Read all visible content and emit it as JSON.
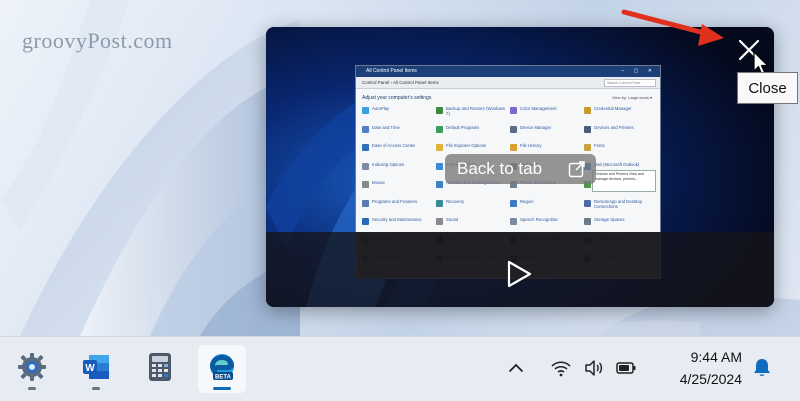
{
  "watermark": "groovyPost.com",
  "pip": {
    "back_to_tab_label": "Back to tab",
    "close_tooltip": "Close",
    "inner_window": {
      "title": "All Control Panel Items",
      "address": "Control Panel  ›  All Control Panel Items",
      "search_placeholder": "Search Control Panel",
      "heading": "Adjust your computer's settings",
      "view_by": "View by:  Large icons ▾",
      "tooltip_text": "Devices and Printers  View and manage devices, printers...",
      "items": [
        {
          "label": "AutoPlay",
          "icon_color": "#3aa0e0"
        },
        {
          "label": "Backup and Restore (Windows 7)",
          "icon_color": "#3b8a3b"
        },
        {
          "label": "Color Management",
          "icon_color": "#7a6ad0"
        },
        {
          "label": "Credential Manager",
          "icon_color": "#c99a2a"
        },
        {
          "label": "Date and Time",
          "icon_color": "#4f7fc8"
        },
        {
          "label": "Default Programs",
          "icon_color": "#3a9d5a"
        },
        {
          "label": "Device Manager",
          "icon_color": "#5a6e8a"
        },
        {
          "label": "Devices and Printers",
          "icon_color": "#4a5e7a"
        },
        {
          "label": "Ease of Access Center",
          "icon_color": "#2f6fc0"
        },
        {
          "label": "File Explorer Options",
          "icon_color": "#e0b23a"
        },
        {
          "label": "File History",
          "icon_color": "#d8a030"
        },
        {
          "label": "Fonts",
          "icon_color": "#c9a23a"
        },
        {
          "label": "Indexing Options",
          "icon_color": "#7d8da3"
        },
        {
          "label": "Internet Options",
          "icon_color": "#3a8ad8"
        },
        {
          "label": "Keyboard",
          "icon_color": "#777777"
        },
        {
          "label": "Mail (Microsoft Outlook)",
          "icon_color": "#2b6cc4"
        },
        {
          "label": "Mouse",
          "icon_color": "#888888"
        },
        {
          "label": "Network and Sharing Center",
          "icon_color": "#3f7fc4"
        },
        {
          "label": "Phone and Modem",
          "icon_color": "#6f7f90"
        },
        {
          "label": "Power Options",
          "icon_color": "#4a9a4a"
        },
        {
          "label": "Programs and Features",
          "icon_color": "#5a7ab0"
        },
        {
          "label": "Recovery",
          "icon_color": "#3a8a9a"
        },
        {
          "label": "Region",
          "icon_color": "#3a7ac8"
        },
        {
          "label": "RemoteApp and Desktop Connections",
          "icon_color": "#4a6aa8"
        },
        {
          "label": "Security and Maintenance",
          "icon_color": "#2a6ab8"
        },
        {
          "label": "Sound",
          "icon_color": "#888888"
        },
        {
          "label": "Speech Recognition",
          "icon_color": "#7a8aa0"
        },
        {
          "label": "Storage Spaces",
          "icon_color": "#6a7a8a"
        },
        {
          "label": "Sync Center",
          "icon_color": "#3aa04a"
        },
        {
          "label": "System",
          "icon_color": "#4a6a9a"
        },
        {
          "label": "Taskbar and Navigation",
          "icon_color": "#4a7ab8"
        },
        {
          "label": "Troubleshooting",
          "icon_color": "#5a7aa8"
        },
        {
          "label": "User Accounts",
          "icon_color": "#4a8ac8"
        },
        {
          "label": "Windows Defender Firewall",
          "icon_color": "#b84a3a"
        },
        {
          "label": "Windows Tools",
          "icon_color": "#6a7a8a"
        },
        {
          "label": "Work Folders",
          "icon_color": "#3a7ab8"
        }
      ]
    }
  },
  "taskbar": {
    "apps": [
      {
        "name": "settings",
        "icon": "gear-icon",
        "active": false
      },
      {
        "name": "word",
        "icon": "word-icon",
        "active": false
      },
      {
        "name": "calculator",
        "icon": "calculator-icon",
        "active": false
      },
      {
        "name": "edge-beta",
        "icon": "edge-beta-icon",
        "active": true,
        "badge": "BETA"
      }
    ],
    "clock": {
      "time": "9:44 AM",
      "date": "4/25/2024"
    },
    "accent_color": "#0f6cbd"
  }
}
